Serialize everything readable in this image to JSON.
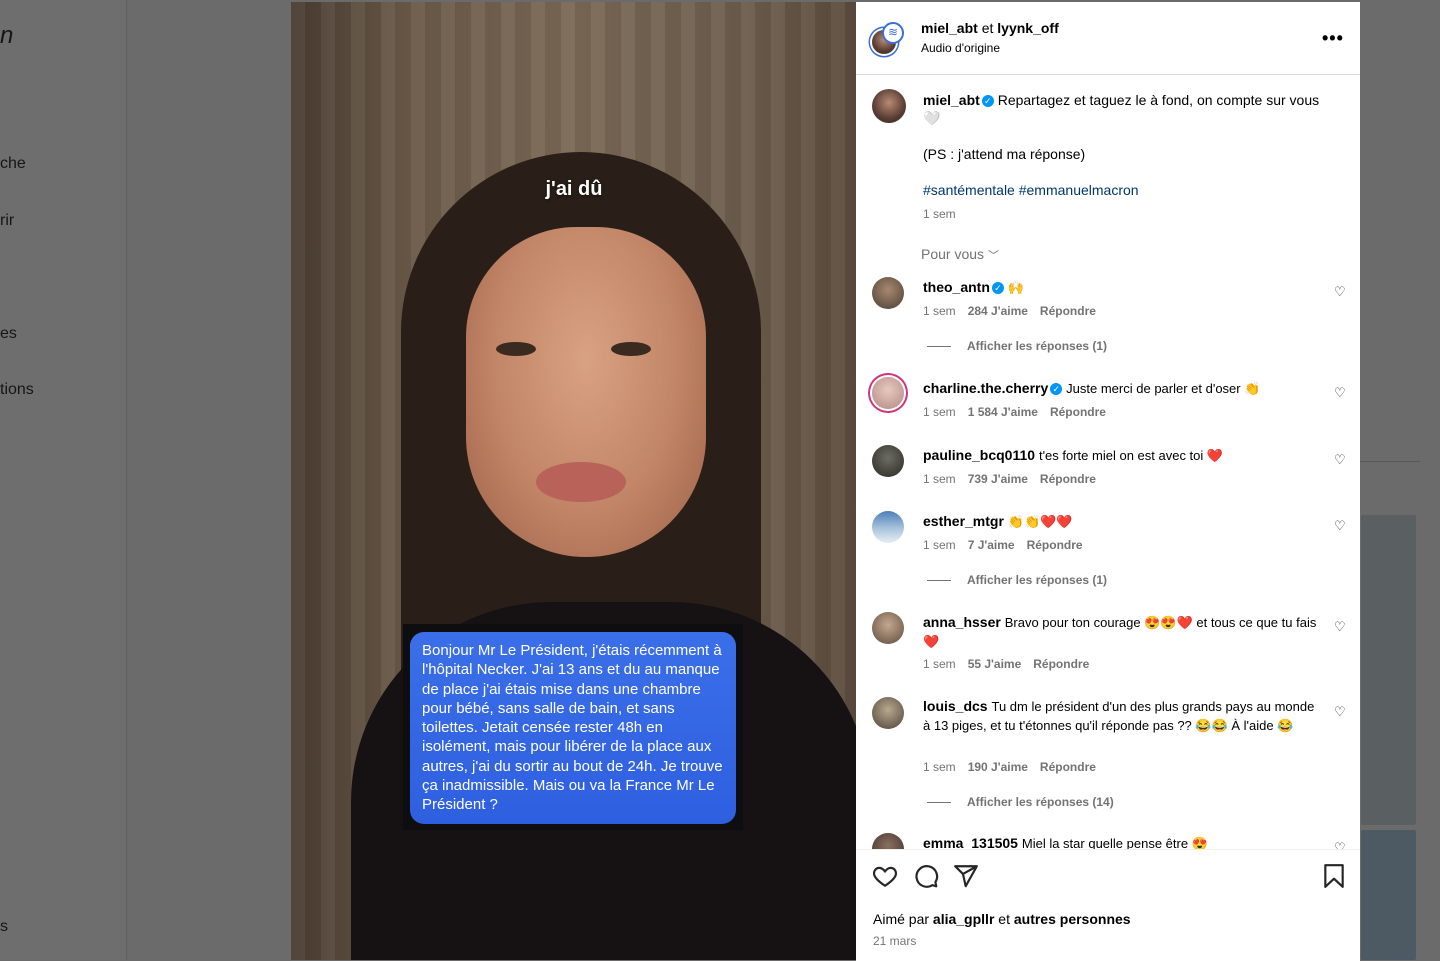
{
  "background": {
    "nav_partial": [
      "che",
      "rir",
      "es",
      "tions",
      "s"
    ],
    "logo_partial": "n"
  },
  "video": {
    "overlay_caption": "j'ai dû",
    "message_text": "Bonjour Mr Le Président, j'étais récemment à l'hôpital Necker. J'ai 13 ans et du au manque de place j'ai étais mise dans une chambre pour bébé, sans salle de bain, et sans toilettes. Jetait censée rester 48h en isolément, mais pour libérer de la place aux autres, j'ai du sortir au bout de 24h. Je trouve ça inadmissible. Mais ou va la France Mr Le Président ?"
  },
  "header": {
    "user1": "miel_abt",
    "conj": " et ",
    "user2": "lyynk_off",
    "audio": "Audio d'origine",
    "more": "•••"
  },
  "caption": {
    "user": "miel_abt",
    "text": "Repartagez et taguez le à fond, on compte sur vous 🤍",
    "ps": "(PS : j'attend ma réponse)",
    "hashtags": "#santémentale #emmanuelmacron",
    "time": "1 sem"
  },
  "sort_label": "Pour vous",
  "comments": [
    {
      "user": "theo_antn",
      "text": "🙌",
      "time": "1 sem",
      "likes": "284 J'aime",
      "reply": "Répondre",
      "replies": "Afficher les réponses (1)"
    },
    {
      "user": "charline.the.cherry",
      "text": "Juste merci de parler et d'oser 👏",
      "time": "1 sem",
      "likes": "1 584 J'aime",
      "reply": "Répondre"
    },
    {
      "user": "pauline_bcq0110",
      "text": "t'es forte miel on est avec toi ❤️",
      "time": "1 sem",
      "likes": "739 J'aime",
      "reply": "Répondre"
    },
    {
      "user": "esther_mtgr",
      "text": "👏👏❤️❤️",
      "time": "1 sem",
      "likes": "7 J'aime",
      "reply": "Répondre",
      "replies": "Afficher les réponses (1)"
    },
    {
      "user": "anna_hsser",
      "text": "Bravo pour ton courage 😍😍❤️ et tous ce que tu fais ❤️",
      "time": "1 sem",
      "likes": "55 J'aime",
      "reply": "Répondre"
    },
    {
      "user": "louis_dcs",
      "text": "Tu dm le président d'un des plus grands pays au monde à 13 piges, et tu t'étonnes qu'il réponde pas ?? 😂😂 À l'aide 😂",
      "time": "1 sem",
      "likes": "190 J'aime",
      "reply": "Répondre",
      "replies": "Afficher les réponses (14)"
    },
    {
      "user": "emma_131505",
      "text": "Miel la star quelle pense être 😍"
    }
  ],
  "footer": {
    "liked_prefix": "Aimé par ",
    "liked_user": "alia_gpllr",
    "liked_mid": " et ",
    "liked_others": "autres personnes",
    "date": "21 mars"
  },
  "colors": {
    "accent": "#0095f6",
    "heart": "#e3173c",
    "bubble": "#3467e4"
  }
}
